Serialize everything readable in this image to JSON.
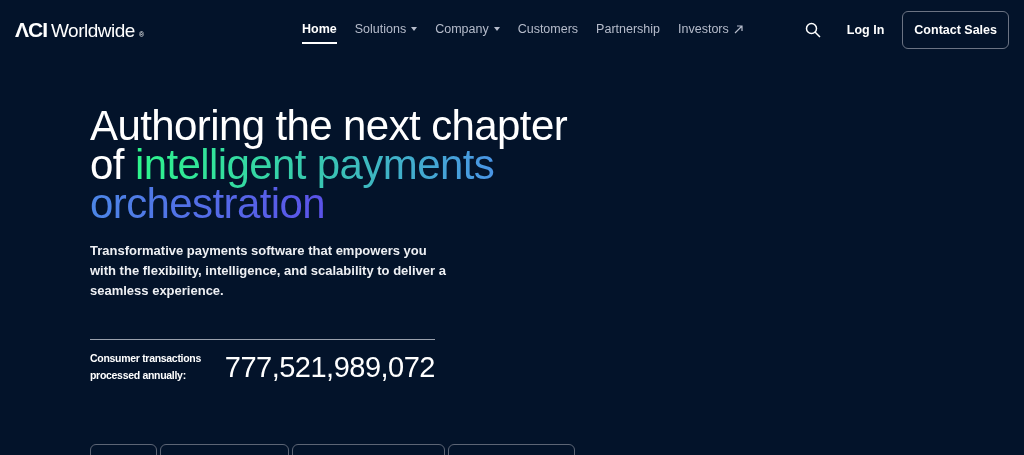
{
  "header": {
    "logo_mark": "ΛCI",
    "logo_text": "Worldwide",
    "logo_reg": "®",
    "nav": [
      {
        "label": "Home",
        "selected": true,
        "kind": "plain"
      },
      {
        "label": "Solutions",
        "selected": false,
        "kind": "dropdown"
      },
      {
        "label": "Company",
        "selected": false,
        "kind": "dropdown"
      },
      {
        "label": "Customers",
        "selected": false,
        "kind": "plain"
      },
      {
        "label": "Partnership",
        "selected": false,
        "kind": "plain"
      },
      {
        "label": "Investors",
        "selected": false,
        "kind": "external"
      }
    ],
    "login": "Log In",
    "cta": "Contact Sales"
  },
  "hero": {
    "headline": [
      [
        {
          "text": "Authoring the next chapter",
          "kind": "plain"
        }
      ],
      [
        {
          "text": "of ",
          "kind": "plain"
        },
        {
          "text": "intelligent payments",
          "kind": "green"
        }
      ],
      [
        {
          "text": "orchestration",
          "kind": "blue"
        }
      ]
    ],
    "description": "Transformative payments software that empowers you with the flexibility, intelligence, and scalability to deliver a seamless experience.",
    "stat_label": "Consumer transactions processed annually:",
    "stat_value": "777,521,989,072"
  }
}
